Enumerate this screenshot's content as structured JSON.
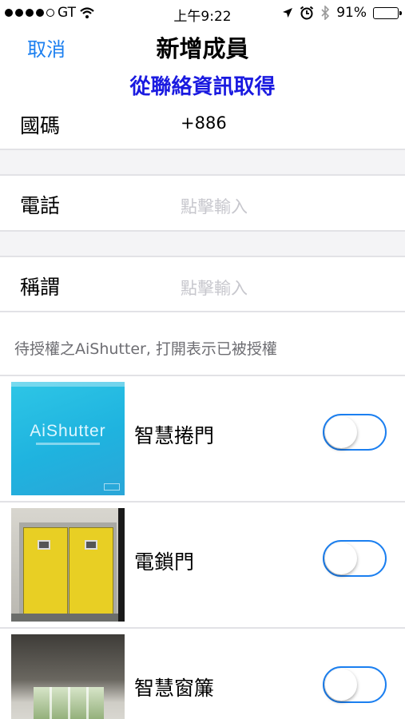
{
  "status_bar": {
    "carrier": "GT",
    "time": "上午9:22",
    "battery": "91%",
    "battery_level": 0.91
  },
  "nav": {
    "cancel_label": "取消",
    "title": "新增成員",
    "contact_link": "從聯絡資訊取得"
  },
  "form": {
    "country_code": {
      "label": "國碼",
      "value": "+886"
    },
    "phone": {
      "label": "電話",
      "placeholder": "點擊輸入"
    },
    "nickname": {
      "label": "稱謂",
      "placeholder": "點擊輸入"
    }
  },
  "authorization_note": "待授權之AiShutter, 打開表示已被授權",
  "devices": [
    {
      "name": "智慧捲門",
      "enabled": false,
      "thumb_text": "AiShutter"
    },
    {
      "name": "電鎖門",
      "enabled": false
    },
    {
      "name": "智慧窗簾",
      "enabled": false
    }
  ],
  "colors": {
    "accent": "#1b7ff0",
    "link": "#1a1ae0",
    "placeholder": "#c7c7cd",
    "note": "#6d6d72"
  },
  "icons": [
    "wifi-icon",
    "location-arrow-icon",
    "alarm-icon",
    "bluetooth-icon",
    "battery-icon"
  ]
}
